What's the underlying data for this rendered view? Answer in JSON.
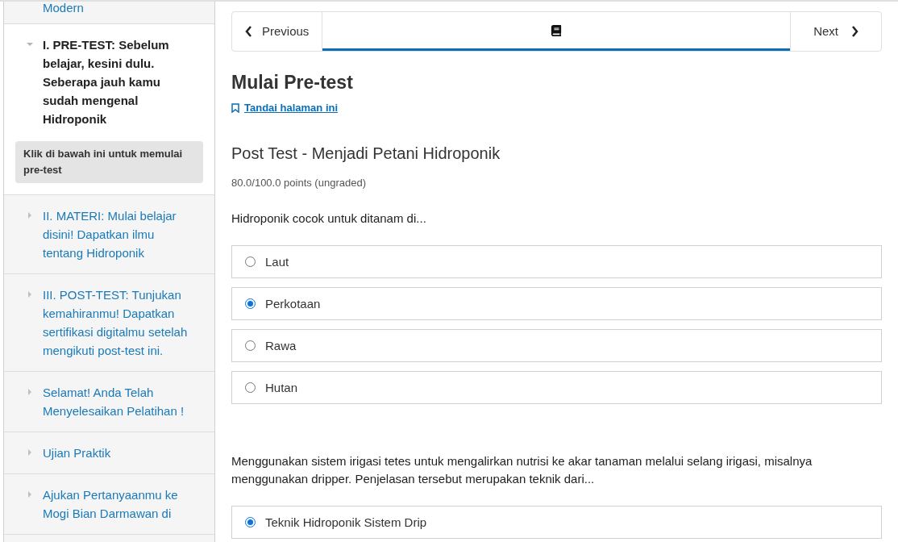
{
  "sidebar": {
    "items": [
      {
        "label": "Modern"
      },
      {
        "label": "I. PRE-TEST: Sebelum belajar, kesini dulu. Seberapa jauh kamu sudah mengenal Hidroponik",
        "expanded": true,
        "current": true,
        "note": "Klik di bawah ini untuk memulai pre-test"
      },
      {
        "label": "II. MATERI: Mulai belajar disini! Dapatkan ilmu tentang Hidroponik",
        "expanded": false,
        "current": false
      },
      {
        "label": "III. POST-TEST: Tunjukan kemahiranmu! Dapatkan sertifikasi digitalmu setelah mengikuti post-test ini.",
        "expanded": false,
        "current": false
      },
      {
        "label": "Selamat! Anda Telah Menyelesaikan Pelatihan !",
        "expanded": false,
        "current": false
      },
      {
        "label": "Ujian Praktik",
        "expanded": false,
        "current": false
      },
      {
        "label": "Ajukan Pertanyaanmu ke Mogi Bian Darmawan di",
        "expanded": false,
        "current": false
      }
    ]
  },
  "nav": {
    "previous": "Previous",
    "next": "Next",
    "tabs": [
      {
        "selected": true
      }
    ]
  },
  "page_title": "Mulai Pre-test",
  "bookmark_link": "Tandai halaman ini",
  "problem": {
    "title": "Post Test - Menjadi Petani Hidroponik",
    "points": "80.0/100.0 points (ungraded)",
    "questions": [
      {
        "prompt": "Hidroponik cocok untuk ditanam di...",
        "options": [
          {
            "label": "Laut",
            "selected": false
          },
          {
            "label": "Perkotaan",
            "selected": true
          },
          {
            "label": "Rawa",
            "selected": false
          },
          {
            "label": "Hutan",
            "selected": false
          }
        ]
      },
      {
        "prompt": "Menggunakan sistem irigasi tetes untuk mengalirkan nutrisi ke akar tanaman melalui selang irigasi, misalnya menggunakan dripper. Penjelasan tersebut merupakan teknik dari...",
        "options": [
          {
            "label": "Teknik Hidroponik Sistem Drip",
            "selected": true
          }
        ]
      }
    ]
  }
}
